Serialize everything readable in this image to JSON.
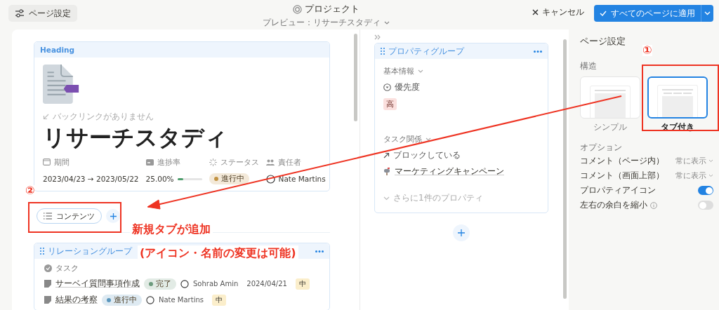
{
  "toolbar": {
    "page_settings_button": "ページ設定",
    "title": "プロジェクト",
    "preview": "プレビュー：リサーチスタディ",
    "cancel_button": "キャンセル",
    "apply_button": "すべてのページに適用"
  },
  "page": {
    "heading_label": "Heading",
    "backlinks": "バックリンクがありません",
    "title": "リサーチスタディ",
    "properties": [
      {
        "kind": "date",
        "label": "期間",
        "value": "2023/04/23 → 2023/05/22"
      },
      {
        "kind": "progress",
        "label": "進捗率",
        "value": "25.00%",
        "level": 0.25
      },
      {
        "kind": "status",
        "label": "ステータス",
        "value": "進行中",
        "color": "#c29343"
      },
      {
        "kind": "person",
        "label": "責任者",
        "value": "Nate Martins"
      }
    ],
    "tabs": [
      {
        "label": "コンテンツ",
        "selected": true
      }
    ],
    "relation_group": {
      "title": "リレーショングループ",
      "relation_label": "タスク",
      "rows": [
        {
          "name": "サーベイ質問事項作成",
          "status": "完了",
          "color": "#6c9b7d",
          "person": "Sohrab Amin",
          "date": "2024/04/21",
          "priority": "中"
        },
        {
          "name": "結果の考察",
          "status": "進行中",
          "color": "#5b97bd",
          "person": "Nate Martins",
          "priority": "中"
        }
      ]
    }
  },
  "property_group": {
    "title": "プロパティグループ",
    "section": "基本情報",
    "priority_label": "優先度",
    "priority_value": "高",
    "relation_section": "タスク関係",
    "blocking_label": "ブロックしている",
    "blocking_item": "マーケティングキャンペーン",
    "more": "さらに1件のプロパティ"
  },
  "settings": {
    "title": "ページ設定",
    "structure_label": "構造",
    "layouts": [
      {
        "label": "シンプル",
        "selected": false
      },
      {
        "label": "タブ付き",
        "selected": true
      }
    ],
    "options_label": "オプション",
    "options": [
      {
        "kind": "select",
        "label": "コメント（ページ内）",
        "value": "常に表示"
      },
      {
        "kind": "select",
        "label": "コメント（画面上部）",
        "value": "常に表示"
      },
      {
        "kind": "toggle",
        "label": "プロパティアイコン",
        "on": true,
        "info": false
      },
      {
        "kind": "toggle",
        "label": "左右の余白を縮小",
        "on": false,
        "info": true
      }
    ]
  },
  "annotations": {
    "markers": [
      "①",
      "②"
    ],
    "notes": [
      "新規タブが追加",
      "(アイコン・名前の変更は可能)"
    ]
  }
}
